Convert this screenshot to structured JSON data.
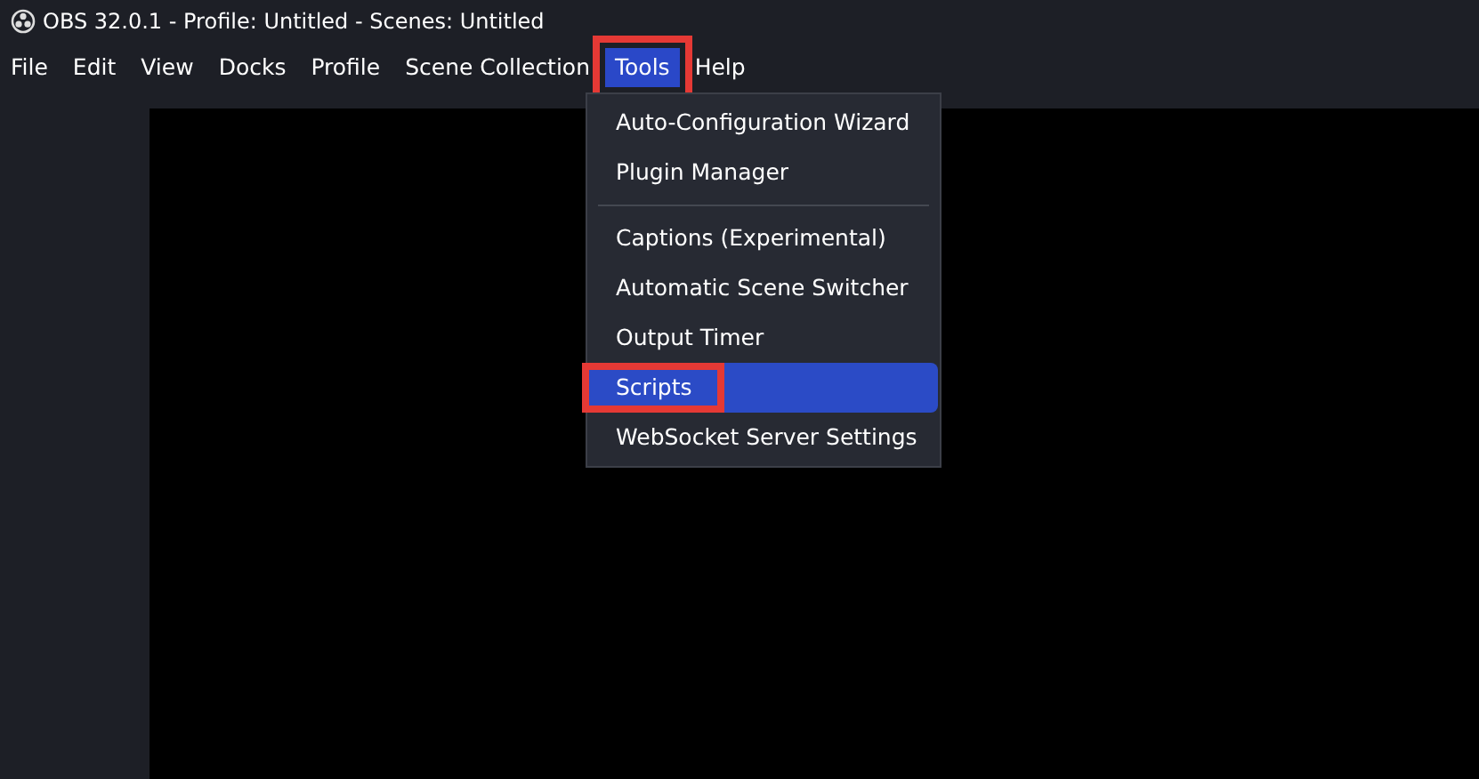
{
  "window": {
    "title": "OBS 32.0.1 - Profile: Untitled - Scenes: Untitled"
  },
  "menu_bar": [
    {
      "label": "File",
      "selected": false,
      "annotated": false
    },
    {
      "label": "Edit",
      "selected": false,
      "annotated": false
    },
    {
      "label": "View",
      "selected": false,
      "annotated": false
    },
    {
      "label": "Docks",
      "selected": false,
      "annotated": false
    },
    {
      "label": "Profile",
      "selected": false,
      "annotated": false
    },
    {
      "label": "Scene Collection",
      "selected": false,
      "annotated": false
    },
    {
      "label": "Tools",
      "selected": true,
      "annotated": true
    },
    {
      "label": "Help",
      "selected": false,
      "annotated": false
    }
  ],
  "dropdown": [
    {
      "kind": "item",
      "label": "Auto-Configuration Wizard",
      "selected": false,
      "annotated": false
    },
    {
      "kind": "item",
      "label": "Plugin Manager",
      "selected": false,
      "annotated": false
    },
    {
      "kind": "separator"
    },
    {
      "kind": "item",
      "label": "Captions (Experimental)",
      "selected": false,
      "annotated": false
    },
    {
      "kind": "item",
      "label": "Automatic Scene Switcher",
      "selected": false,
      "annotated": false
    },
    {
      "kind": "item",
      "label": "Output Timer",
      "selected": false,
      "annotated": false
    },
    {
      "kind": "item",
      "label": "Scripts",
      "selected": true,
      "annotated": true
    },
    {
      "kind": "item",
      "label": "WebSocket Server Settings",
      "selected": false,
      "annotated": false
    }
  ]
}
